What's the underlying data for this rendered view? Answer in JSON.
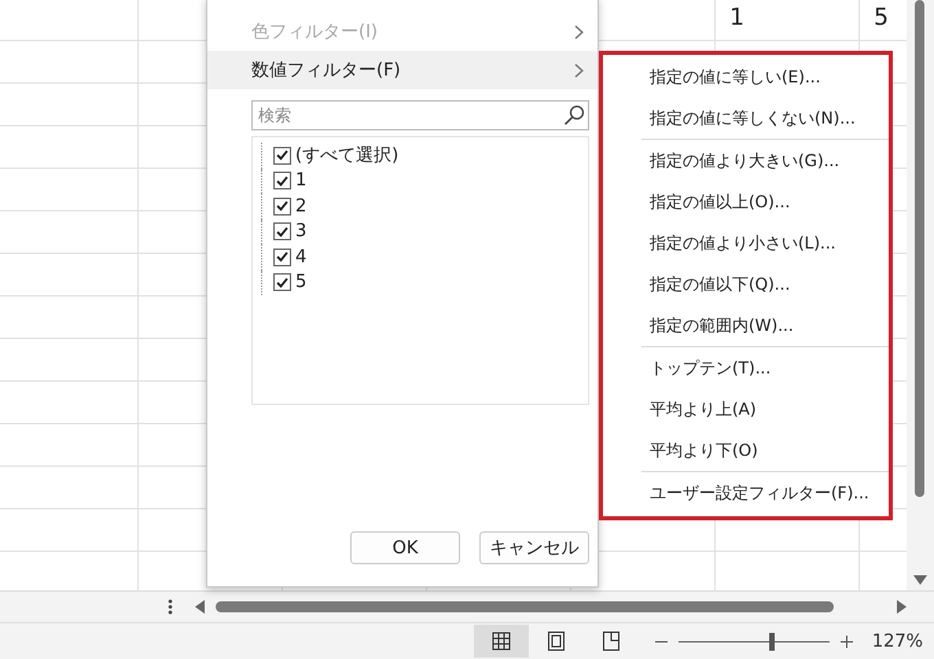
{
  "sheet": {
    "visible_cells": [
      {
        "value": "1"
      },
      {
        "value": "5"
      }
    ]
  },
  "filter_panel": {
    "menu": [
      {
        "label": "色フィルター(I)",
        "disabled": true,
        "selected": false
      },
      {
        "label": "数値フィルター(F)",
        "disabled": false,
        "selected": true
      }
    ],
    "search": {
      "placeholder": "検索"
    },
    "values": [
      {
        "label": "(すべて選択)",
        "checked": true
      },
      {
        "label": "1",
        "checked": true
      },
      {
        "label": "2",
        "checked": true
      },
      {
        "label": "3",
        "checked": true
      },
      {
        "label": "4",
        "checked": true
      },
      {
        "label": "5",
        "checked": true
      }
    ],
    "buttons": [
      {
        "label": "OK"
      },
      {
        "label": "キャンセル"
      }
    ]
  },
  "number_filter_menu": {
    "highlighted": true,
    "groups": [
      [
        "指定の値に等しい(E)...",
        "指定の値に等しくない(N)..."
      ],
      [
        "指定の値より大きい(G)...",
        "指定の値以上(O)...",
        "指定の値より小さい(L)...",
        "指定の値以下(Q)...",
        "指定の範囲内(W)..."
      ],
      [
        "トップテン(T)...",
        "平均より上(A)",
        "平均より下(O)"
      ],
      [
        "ユーザー設定フィルター(F)..."
      ]
    ]
  },
  "status_bar": {
    "views": [
      {
        "selected": true
      },
      {
        "selected": false
      },
      {
        "selected": false
      }
    ],
    "zoom": {
      "level": 0.62,
      "reading": "127%"
    }
  }
}
